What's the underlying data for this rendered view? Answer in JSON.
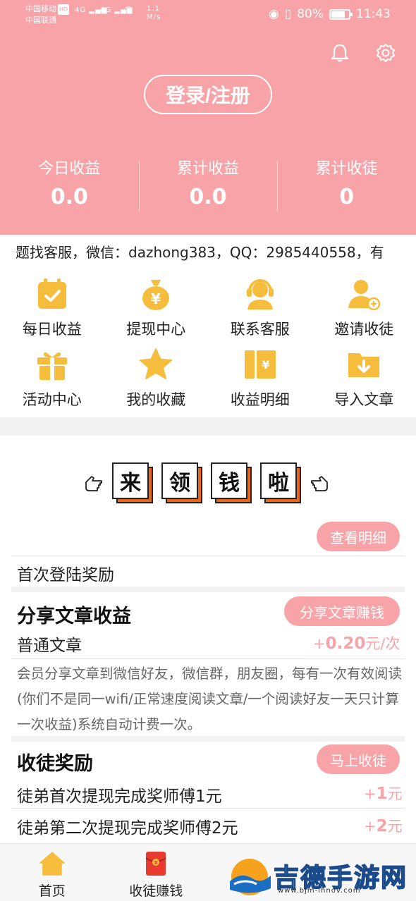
{
  "status_bar": {
    "carrier1": "中国移动",
    "carrier_badge": "HD",
    "carrier2": "中国联通",
    "signal1": "4G",
    "signal2": "4G",
    "speed": "1.1 M/s",
    "battery_pct": "80%",
    "battery_level": 0.8,
    "time": "11:43"
  },
  "header": {
    "login_label": "登录/注册",
    "stats": [
      {
        "label": "今日收益",
        "value": "0.0"
      },
      {
        "label": "累计收益",
        "value": "0.0"
      },
      {
        "label": "累计收徒",
        "value": "0"
      }
    ]
  },
  "marquee": {
    "text": "题找客服，微信：dazhong383，QQ：2985440558，有"
  },
  "grid": [
    {
      "label": "每日收益",
      "icon": "calendar-check-icon"
    },
    {
      "label": "提现中心",
      "icon": "money-bag-icon"
    },
    {
      "label": "联系客服",
      "icon": "headset-icon"
    },
    {
      "label": "邀请收徒",
      "icon": "add-user-icon"
    },
    {
      "label": "活动中心",
      "icon": "gift-icon"
    },
    {
      "label": "我的收藏",
      "icon": "star-icon"
    },
    {
      "label": "收益明细",
      "icon": "ticket-icon"
    },
    {
      "label": "导入文章",
      "icon": "folder-download-icon"
    }
  ],
  "banner": {
    "chars": [
      "来",
      "领",
      "钱",
      "啦"
    ]
  },
  "rewards": {
    "detail_btn": "查看明细",
    "first_login": "首次登陆奖励",
    "share_title": "分享文章收益",
    "share_btn": "分享文章赚钱",
    "normal_article": "普通文章",
    "normal_price_prefix": "+",
    "normal_price_value": "0.20",
    "normal_price_unit": "元/次",
    "desc": "会员分享文章到微信好友，微信群，朋友圈，每有一次有效阅读(你们不是同一wifi/正常速度阅读文章/一个阅读好友一天只计算一次收益)系统自动计费一次。",
    "recruit_title": "收徒奖励",
    "recruit_btn": "马上收徒",
    "recruit_items": [
      {
        "text": "徒弟首次提现完成奖师傅1元",
        "prefix": "+",
        "value": "1",
        "unit": "元"
      },
      {
        "text": "徒弟第二次提现完成奖师傅2元",
        "prefix": "+",
        "value": "2",
        "unit": "元"
      }
    ]
  },
  "bottom_nav": [
    {
      "label": "首页",
      "icon": "home-icon"
    },
    {
      "label": "收徒赚钱",
      "icon": "red-envelope-icon"
    }
  ],
  "watermark": {
    "text": "吉德手游网",
    "url": "www.bjm-ihnov.com"
  },
  "colors": {
    "primary": "#f7a3a8",
    "icon_yellow": "#f6bd3c",
    "accent_orange": "#e8661c"
  }
}
